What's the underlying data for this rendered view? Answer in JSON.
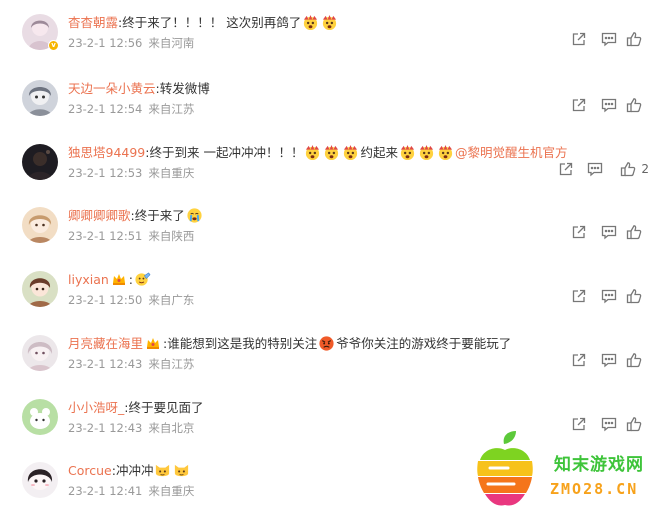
{
  "comments": [
    {
      "id": "c1",
      "username": "杳杳朝露",
      "text_segments": [
        ":终于来了！！！！ 这次别再鸽了"
      ],
      "emoji": [
        "shock-emoji",
        "shock-emoji"
      ],
      "time": "23-2-1 12:56",
      "location": "来自河南",
      "likes": "",
      "verified": true
    },
    {
      "id": "c2",
      "username": "天边一朵小黄云",
      "text_segments": [
        ":转发微博"
      ],
      "time": "23-2-1 12:54",
      "location": "来自江苏",
      "likes": ""
    },
    {
      "id": "c3",
      "username": "独思塔94499",
      "text_segments": [
        ":终于到来 一起冲冲冲！！！",
        "约起来"
      ],
      "mention": "@黎明觉醒生机官方",
      "time": "23-2-1 12:53",
      "location": "来自重庆",
      "likes": "2"
    },
    {
      "id": "c4",
      "username": "卿卿卿卿歌",
      "text_segments": [
        ":终于来了"
      ],
      "time": "23-2-1 12:51",
      "location": "来自陕西",
      "likes": ""
    },
    {
      "id": "c5",
      "username": "liyxian",
      "text_segments": [
        ":"
      ],
      "time": "23-2-1 12:50",
      "location": "来自广东",
      "likes": ""
    },
    {
      "id": "c6",
      "username": "月亮藏在海里",
      "text_segments": [
        ":谁能想到这是我的特别关注",
        "爷爷你关注的游戏终于要能玩了"
      ],
      "time": "23-2-1 12:43",
      "location": "来自江苏",
      "likes": ""
    },
    {
      "id": "c7",
      "username": "小小浩呀_",
      "text_segments": [
        ":终于要见面了"
      ],
      "time": "23-2-1 12:43",
      "location": "来自北京",
      "likes": ""
    },
    {
      "id": "c8",
      "username": "Corcue",
      "text_segments": [
        ":冲冲冲"
      ],
      "time": "23-2-1 12:41",
      "location": "来自重庆",
      "likes": ""
    }
  ],
  "icons": {
    "forward": "forward-icon",
    "comment": "comment-icon",
    "like": "like-icon"
  },
  "watermark": {
    "title": "知末游戏网",
    "domain": "ZMO28.CN"
  },
  "colors": {
    "username": "#eb7350",
    "meta": "#999999",
    "text": "#333333",
    "icon": "#777777"
  }
}
